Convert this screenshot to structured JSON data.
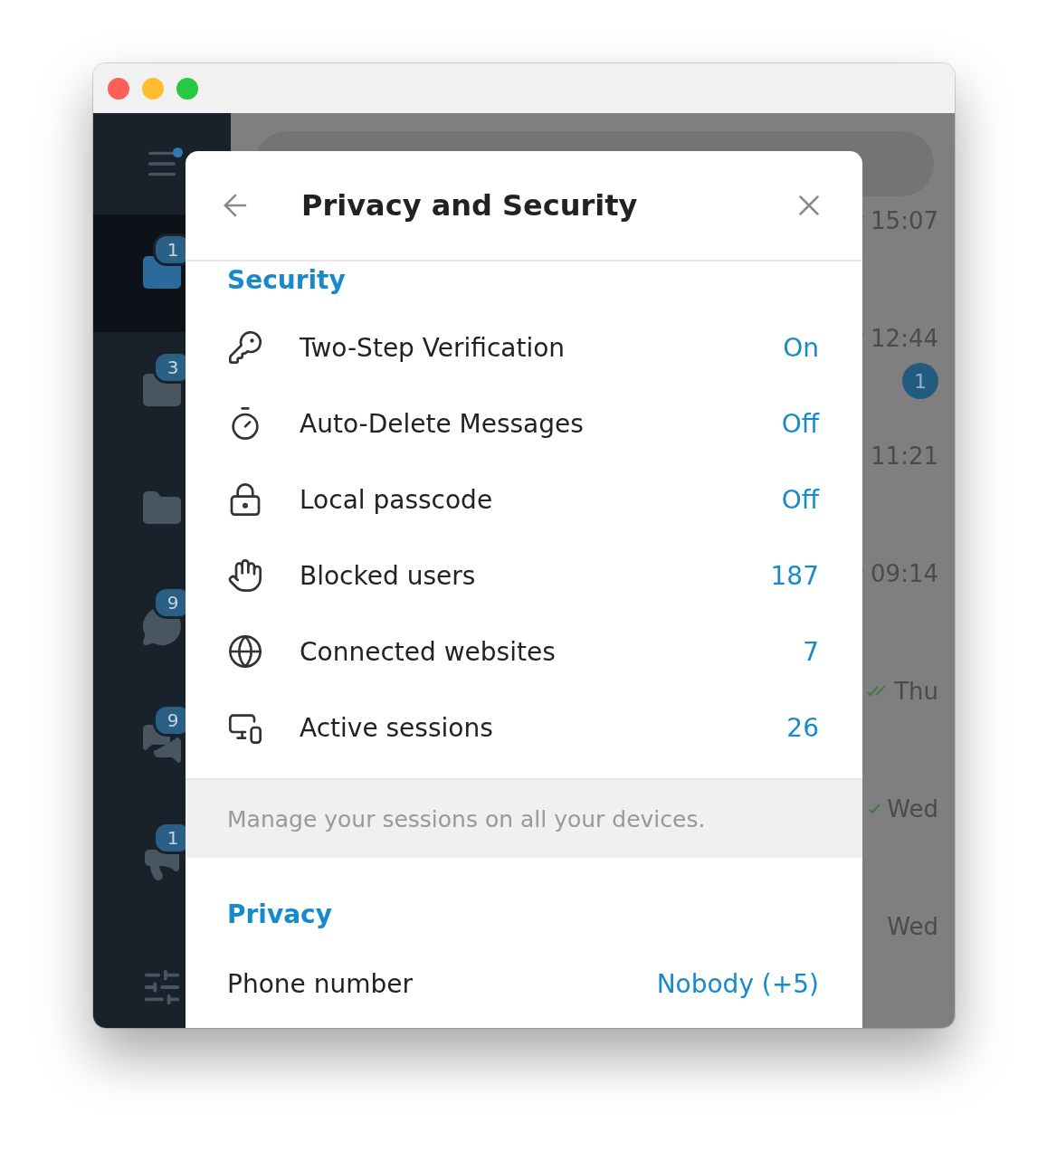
{
  "sidebar": {
    "folders": [
      {
        "badge": "1",
        "selected": true
      },
      {
        "badge": "3",
        "selected": false
      },
      {
        "selected": false
      },
      {
        "badge": "9",
        "selected": false
      },
      {
        "badge": "9",
        "selected": false
      },
      {
        "badge": "1",
        "selected": false
      }
    ]
  },
  "chat_list": [
    {
      "time": "15:07",
      "sent": true
    },
    {
      "time": "12:44",
      "sent": true,
      "unread": "1"
    },
    {
      "time": "11:21",
      "sent": false
    },
    {
      "time": "09:14",
      "sent": true
    },
    {
      "time": "Thu",
      "sent": true,
      "read": true
    },
    {
      "time": "Wed",
      "sent": true,
      "read": false
    },
    {
      "time": "Wed",
      "sent": false
    }
  ],
  "dialog": {
    "title": "Privacy and Security",
    "security": {
      "heading": "Security",
      "items": [
        {
          "label": "Two-Step Verification",
          "value": "On"
        },
        {
          "label": "Auto-Delete Messages",
          "value": "Off"
        },
        {
          "label": "Local passcode",
          "value": "Off"
        },
        {
          "label": "Blocked users",
          "value": "187"
        },
        {
          "label": "Connected websites",
          "value": "7"
        },
        {
          "label": "Active sessions",
          "value": "26"
        }
      ],
      "note": "Manage your sessions on all your devices."
    },
    "privacy": {
      "heading": "Privacy",
      "items": [
        {
          "label": "Phone number",
          "value": "Nobody (+5)"
        }
      ]
    }
  }
}
